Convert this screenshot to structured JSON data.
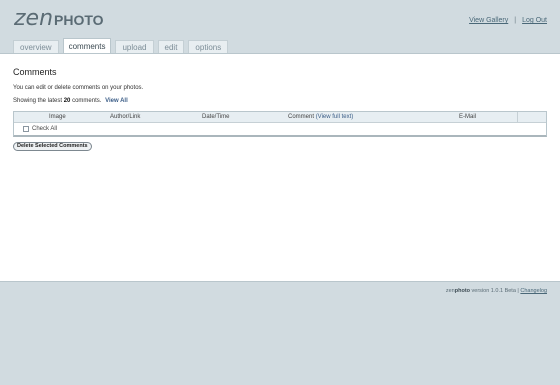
{
  "logo": {
    "zen": "zen",
    "photo": "PHOTO"
  },
  "top_links": {
    "view_gallery": "View Gallery",
    "separator": "|",
    "log_out": "Log Out"
  },
  "tabs": [
    {
      "label": "overview",
      "active": false
    },
    {
      "label": "comments",
      "active": true
    },
    {
      "label": "upload",
      "active": false
    },
    {
      "label": "edit",
      "active": false
    },
    {
      "label": "options",
      "active": false
    }
  ],
  "main": {
    "title": "Comments",
    "intro": "You can edit or delete comments on your photos.",
    "showing_prefix": "Showing the latest",
    "showing_count": "20",
    "showing_suffix": "comments.",
    "view_all": "View All"
  },
  "table": {
    "columns": {
      "image": "Image",
      "author": "Author/Link",
      "datetime": "Date/Time",
      "comment": "Comment",
      "view_full_text": "(View full text)",
      "email": "E-Mail"
    },
    "check_all": "Check All"
  },
  "delete_button": "Delete Selected Comments",
  "footer": {
    "brand_prefix": "zen",
    "brand_suffix": "photo",
    "version": "version 1.0.1 Beta",
    "separator": "|",
    "changelog": "Changelog"
  }
}
